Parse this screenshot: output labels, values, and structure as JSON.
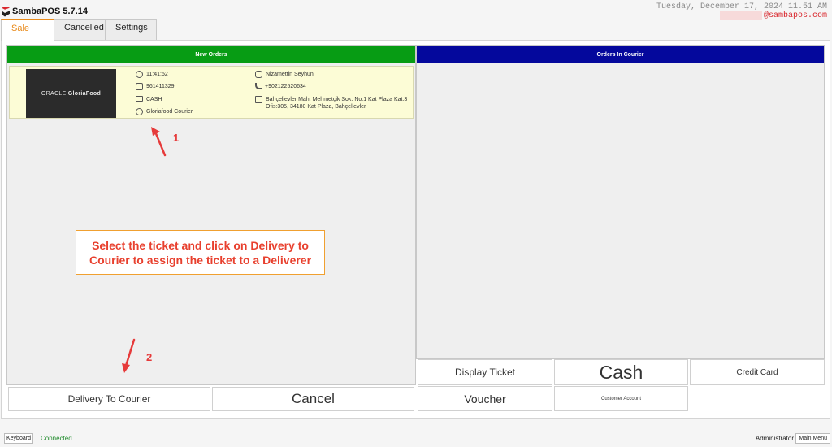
{
  "app": {
    "title": "SambaPOS 5.7.14"
  },
  "header": {
    "datetime": "Tuesday, December 17, 2024 11.51 AM",
    "user_email": "@sambapos.com"
  },
  "tabs": [
    {
      "label": "Sale",
      "active": true
    },
    {
      "label": "Cancelled",
      "active": false
    },
    {
      "label": "Settings",
      "active": false
    }
  ],
  "panels": {
    "new_orders": {
      "title": "New Orders",
      "color": "#079c14"
    },
    "orders_in_courier": {
      "title": "Orders In Courier",
      "color": "#04089c"
    }
  },
  "order": {
    "logo_text_light": "ORACLE",
    "logo_text_bold": "GloriaFood",
    "time": "11:41:52",
    "order_number": "961411329",
    "payment": "CASH",
    "courier": "Gloriafood Courier",
    "customer_name": "Nizamettin Seyhun",
    "phone": "+902122520634",
    "address": "Bahçelievler Mah. Mehmetçik Sok. No:1 Kat Plaza Kat:3 Ofis:305, 34180 Kat Plaza, Bahçelievler"
  },
  "annotations": {
    "step1": "1",
    "step2": "2",
    "instruction": "Select the ticket and click on Delivery to Courier to assign the ticket to a Deliverer",
    "color": "#e63a3a"
  },
  "buttons": {
    "delivery_to_courier": "Delivery To Courier",
    "cancel": "Cancel",
    "display_ticket": "Display Ticket",
    "cash": "Cash",
    "credit_card": "Credit Card",
    "voucher": "Voucher",
    "customer_account": "Customer Account"
  },
  "footer": {
    "keyboard": "Keyboard",
    "status": "Connected",
    "user": "Administrator",
    "main_menu": "Main Menu"
  }
}
